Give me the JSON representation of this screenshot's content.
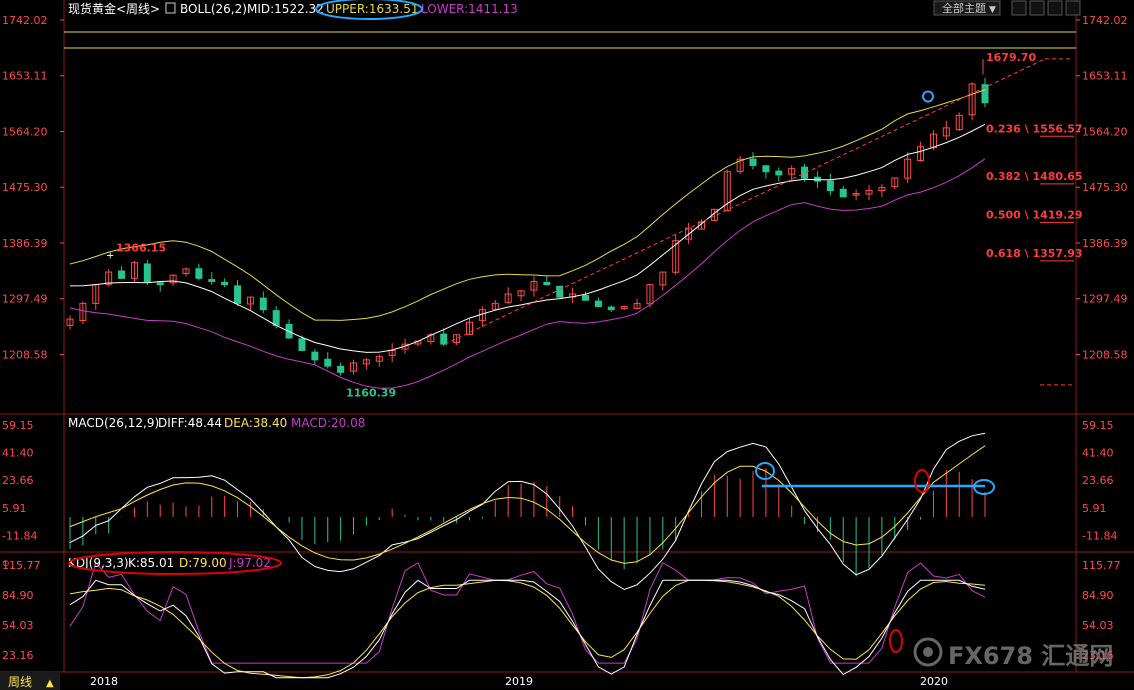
{
  "colors": {
    "up": "#ff4a4a",
    "down": "#27c48f",
    "boll_mid": "#ffffff",
    "boll_upper": "#e6d94a",
    "boll_lower": "#c83cc8",
    "diff": "#ffffff",
    "dea": "#ffe44d",
    "macd": "#c83cc8",
    "k": "#ffffff",
    "d": "#ffe44d",
    "j": "#c83cc8",
    "axis": "#ff4a4a",
    "grid": "#8b1a1a",
    "fib": "#ff3b3b",
    "annot_blue": "#22a8ff",
    "annot_red": "#e00000"
  },
  "header": {
    "symbol": "现货黄金<周线>",
    "indicator": "BOLL(26,2)",
    "mid": "MID:1522.32",
    "upper": "UPPER:1633.51",
    "lower": "LOWER:1411.13",
    "dropdown": "全部主题"
  },
  "macd_header": {
    "name": "MACD(26,12,9)",
    "diff": "DIFF:48.44",
    "dea": "DEA:38.40",
    "macd": "MACD:20.08"
  },
  "kdj_header": {
    "name": "KDJ(9,3,3)",
    "k": "K:85.01",
    "d": "D:79.00",
    "j": "J:97.02"
  },
  "bottom": {
    "period": "周线",
    "years": [
      "2018",
      "2019",
      "2020"
    ]
  },
  "watermark": "FX678 汇通网",
  "price_axis": {
    "left": [
      "1742.02",
      "1653.11",
      "1564.20",
      "1475.30",
      "1386.39",
      "1297.49",
      "1208.58"
    ],
    "right": [
      "1742.02",
      "1653.11",
      "1564.20",
      "1475.30",
      "1386.39",
      "1297.49",
      "1208.58"
    ]
  },
  "macd_axis": [
    "59.15",
    "41.40",
    "23.66",
    "5.91",
    "-11.84"
  ],
  "kdj_axis": [
    "115.77",
    "84.90",
    "54.03",
    "23.16"
  ],
  "annotations": {
    "high_2018": "1366.15",
    "low_2018": "1160.39",
    "high_2020": "1679.70"
  },
  "fib": [
    {
      "label": "0.236 \\ 1556.57",
      "value": 1556.57
    },
    {
      "label": "0.382 \\ 1480.65",
      "value": 1480.65
    },
    {
      "label": "0.500 \\ 1419.29",
      "value": 1419.29
    },
    {
      "label": "0.618 \\ 1357.93",
      "value": 1357.93
    }
  ],
  "chart_data": {
    "type": "candlestick",
    "title": "现货黄金<周线>",
    "ylim": [
      1160,
      1742
    ],
    "x_labels": [
      "2018",
      "2019",
      "2020"
    ],
    "key_points": [
      {
        "date": "2018",
        "label": "1366.15",
        "value": 1366.15
      },
      {
        "date": "2018",
        "label": "1160.39",
        "value": 1160.39
      },
      {
        "date": "2020",
        "label": "1679.70",
        "value": 1679.7
      }
    ],
    "boll": {
      "mid": 1522.32,
      "upper": 1633.51,
      "lower": 1411.13
    },
    "macd": {
      "diff": 48.44,
      "dea": 38.4,
      "macd": 20.08,
      "ylim": [
        -20,
        65
      ]
    },
    "kdj": {
      "k": 85.01,
      "d": 79.0,
      "j": 97.02,
      "ylim": [
        10,
        125
      ]
    },
    "close_path": [
      1265,
      1290,
      1320,
      1340,
      1330,
      1355,
      1325,
      1320,
      1335,
      1345,
      1330,
      1325,
      1320,
      1290,
      1300,
      1280,
      1255,
      1235,
      1215,
      1200,
      1190,
      1180,
      1195,
      1200,
      1205,
      1215,
      1225,
      1230,
      1240,
      1225,
      1240,
      1260,
      1280,
      1290,
      1305,
      1310,
      1325,
      1320,
      1300,
      1305,
      1295,
      1285,
      1280,
      1285,
      1290,
      1320,
      1340,
      1390,
      1410,
      1420,
      1440,
      1500,
      1520,
      1510,
      1500,
      1495,
      1505,
      1490,
      1485,
      1470,
      1460,
      1465,
      1470,
      1475,
      1490,
      1520,
      1540,
      1560,
      1570,
      1590,
      1640,
      1610
    ]
  }
}
